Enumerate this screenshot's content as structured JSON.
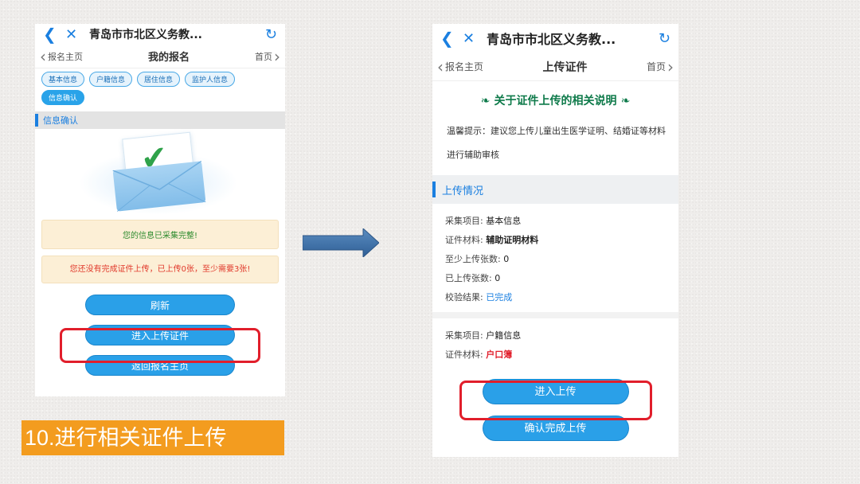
{
  "colors": {
    "accent": "#2aa0e8",
    "highlight": "#e11e2b",
    "caption_bg": "#f39c1f",
    "success": "#2d8b2d"
  },
  "left_phone": {
    "topbar_title": "青岛市市北区义务教...",
    "nav": {
      "back_label": "报名主页",
      "title": "我的报名",
      "home_label": "首页"
    },
    "tabs": [
      {
        "label": "基本信息"
      },
      {
        "label": "户籍信息"
      },
      {
        "label": "居住信息"
      },
      {
        "label": "监护人信息"
      },
      {
        "label": "信息确认"
      }
    ],
    "section_title": "信息确认",
    "notice_ok": "您的信息已采集完整!",
    "notice_warn": "您还没有完成证件上传，已上传0张，至少需要3张!",
    "buttons": {
      "refresh": "刷新",
      "upload": "进入上传证件",
      "back_home": "返回报名主页"
    }
  },
  "caption": "10.进行相关证件上传",
  "right_phone": {
    "topbar_title": "青岛市市北区义务教...",
    "nav": {
      "back_label": "报名主页",
      "title": "上传证件",
      "home_label": "首页"
    },
    "header_title": "关于证件上传的相关说明",
    "tip": "温馨提示：建议您上传儿童出生医学证明、结婚证等材料进行辅助审核",
    "section_title": "上传情况",
    "item1": {
      "project_label": "采集项目:",
      "project_value": "基本信息",
      "material_label": "证件材料:",
      "material_value": "辅助证明材料",
      "min_label": "至少上传张数:",
      "min_value": "0",
      "uploaded_label": "已上传张数:",
      "uploaded_value": "0",
      "result_label": "校验结果:",
      "result_value": "已完成"
    },
    "item2": {
      "project_label": "采集项目:",
      "project_value": "户籍信息",
      "material_label": "证件材料:",
      "material_value": "户口簿"
    },
    "buttons": {
      "enter_upload": "进入上传",
      "confirm": "确认完成上传"
    }
  }
}
